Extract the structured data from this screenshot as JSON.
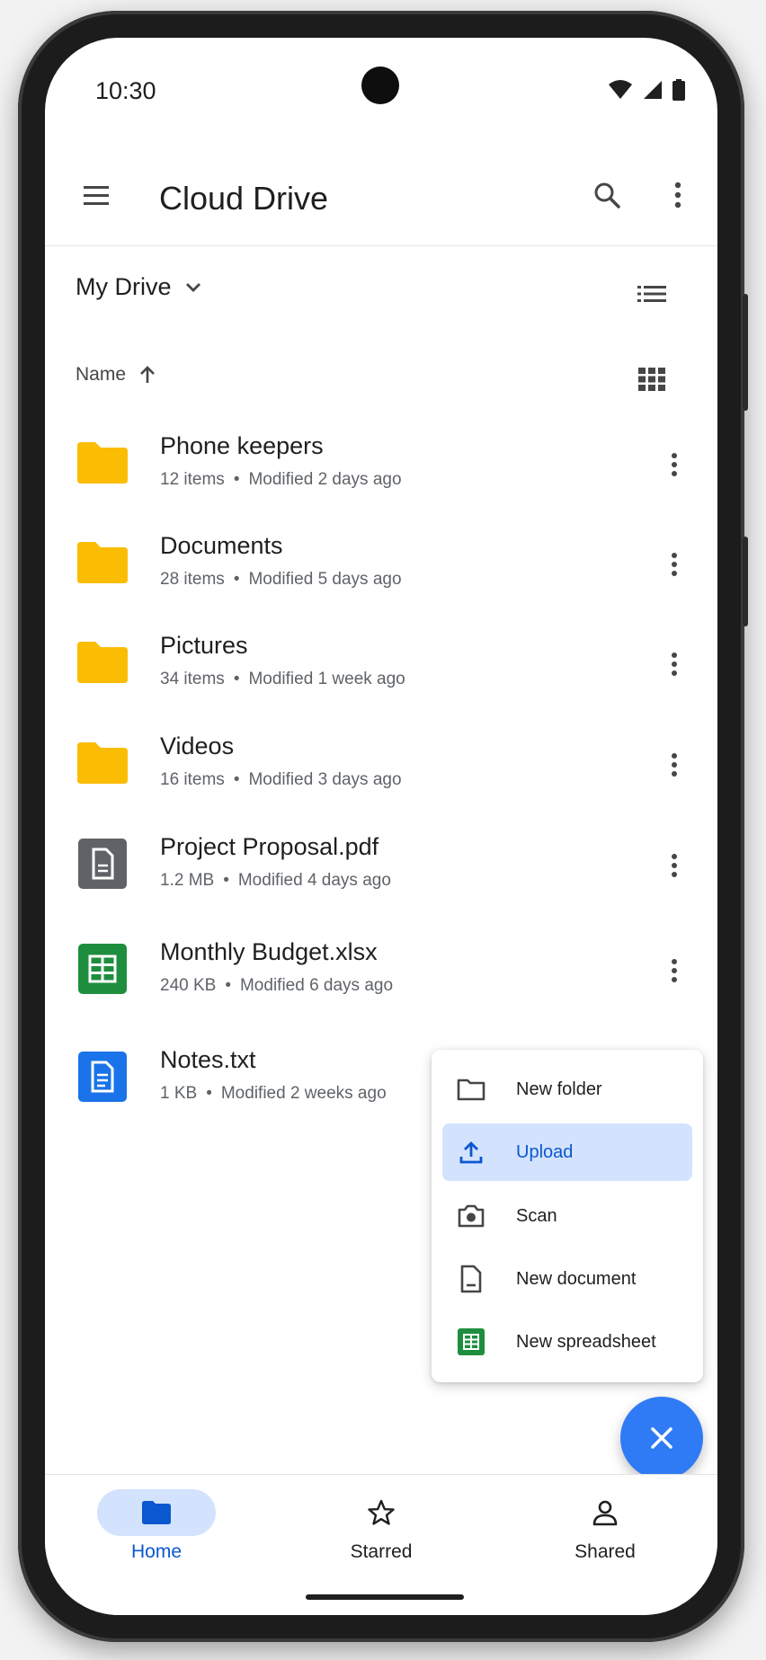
{
  "status_bar": {
    "time": "10:30"
  },
  "app_bar": {
    "title": "Cloud Drive",
    "menu_icon": "hamburger-menu-icon",
    "search_icon": "search-icon",
    "overflow_icon": "more-vert-icon"
  },
  "drive_selector": {
    "label": "My Drive",
    "icon": "chevron-down-icon",
    "view_icon": "list-view-icon"
  },
  "sort": {
    "label": "Name",
    "direction_icon": "arrow-up-icon",
    "view_icon": "grid-view-icon"
  },
  "files": [
    {
      "name": "Phone keepers",
      "size": "12 items",
      "modified": "Modified 2 days ago",
      "type": "folder"
    },
    {
      "name": "Documents",
      "size": "28 items",
      "modified": "Modified 5 days ago",
      "type": "folder"
    },
    {
      "name": "Pictures",
      "size": "34 items",
      "modified": "Modified 1 week ago",
      "type": "folder"
    },
    {
      "name": "Videos",
      "size": "16 items",
      "modified": "Modified 3 days ago",
      "type": "folder"
    },
    {
      "name": "Project Proposal.pdf",
      "size": "1.2 MB",
      "modified": "Modified 4 days ago",
      "type": "pdf"
    },
    {
      "name": "Monthly Budget.xlsx",
      "size": "240 KB",
      "modified": "Modified 6 days ago",
      "type": "spreadsheet"
    },
    {
      "name": "Notes.txt",
      "size": "1 KB",
      "modified": "Modified 2 weeks ago",
      "type": "text"
    }
  ],
  "meta_separator": "•",
  "new_menu": {
    "items": [
      {
        "label": "New folder",
        "icon": "folder-outline-icon"
      },
      {
        "label": "Upload",
        "icon": "upload-icon",
        "selected": true
      },
      {
        "label": "Scan",
        "icon": "camera-icon"
      },
      {
        "label": "New document",
        "icon": "document-icon"
      },
      {
        "label": "New spreadsheet",
        "icon": "spreadsheet-icon"
      }
    ]
  },
  "fab": {
    "icon": "close-icon"
  },
  "bottom_nav": {
    "items": [
      {
        "label": "Home",
        "icon": "folder-icon",
        "active": true
      },
      {
        "label": "Starred",
        "icon": "star-icon"
      },
      {
        "label": "Shared",
        "icon": "person-icon"
      }
    ]
  },
  "colors": {
    "accent": "#0b57d0",
    "accent_container": "#d3e3fd",
    "fab": "#2f7bf5",
    "folder": "#fbbc04",
    "pdf": "#5f6368",
    "spreadsheet": "#1e8e3e",
    "document": "#1a73e8"
  }
}
